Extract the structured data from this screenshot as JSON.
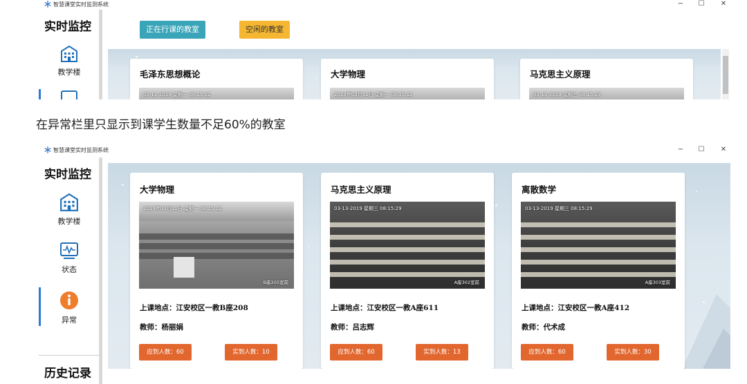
{
  "app": {
    "title": "智慧课堂实时监测系统"
  },
  "window_controls": {
    "minimize": "−",
    "maximize": "☐",
    "close": "✕"
  },
  "sidebar": {
    "title": "实时监控",
    "items": [
      {
        "label": "教学楼",
        "icon": "building-icon"
      },
      {
        "label": "状态",
        "icon": "pulse-icon"
      },
      {
        "label": "异常",
        "icon": "alert-icon"
      }
    ],
    "history_label": "历史记录"
  },
  "top_screenshot": {
    "filters": [
      {
        "label": "正在行课的教室",
        "color": "#3aa4b8"
      },
      {
        "label": "空闲的教室",
        "color": "#f5b731"
      }
    ],
    "cards": [
      {
        "course": "毛泽东思想概论",
        "timestamp": "03-11-2019 星期一 08:15:12"
      },
      {
        "course": "大学物理",
        "timestamp": "2019年03月11日 星期一 08:15:12"
      },
      {
        "course": "马克思主义原理",
        "timestamp": "03-13-2019 星期三 08:15:29"
      }
    ]
  },
  "caption": "在异常栏里只显示到课学生数量不足60%的教室",
  "bottom_screenshot": {
    "cards": [
      {
        "course": "大学物理",
        "timestamp": "2019年03月11日 星期一 08:15:12",
        "room_tag": "B座205室前",
        "location": "上课地点：江安校区一教B座208",
        "teacher": "教师：杨丽娟",
        "expected": "应到人数：60",
        "actual": "实到人数：10"
      },
      {
        "course": "马克思主义原理",
        "timestamp": "03-13-2019 星期三 08:15:29",
        "room_tag": "A座302室前",
        "location": "上课地点：江安校区一教A座611",
        "teacher": "教师：吕志辉",
        "expected": "应到人数：60",
        "actual": "实到人数：13"
      },
      {
        "course": "离散数学",
        "timestamp": "03-13-2019 星期三 08:15:29",
        "room_tag": "A座303室前",
        "location": "上课地点：江安校区一教A座412",
        "teacher": "教师：代术成",
        "expected": "应到人数：60",
        "actual": "实到人数：30"
      }
    ]
  },
  "colors": {
    "count_button": "#e2672f",
    "active_nav": "#2b7bd5",
    "alert_icon": "#ee7d2c",
    "nav_icon": "#1f6fb8"
  }
}
